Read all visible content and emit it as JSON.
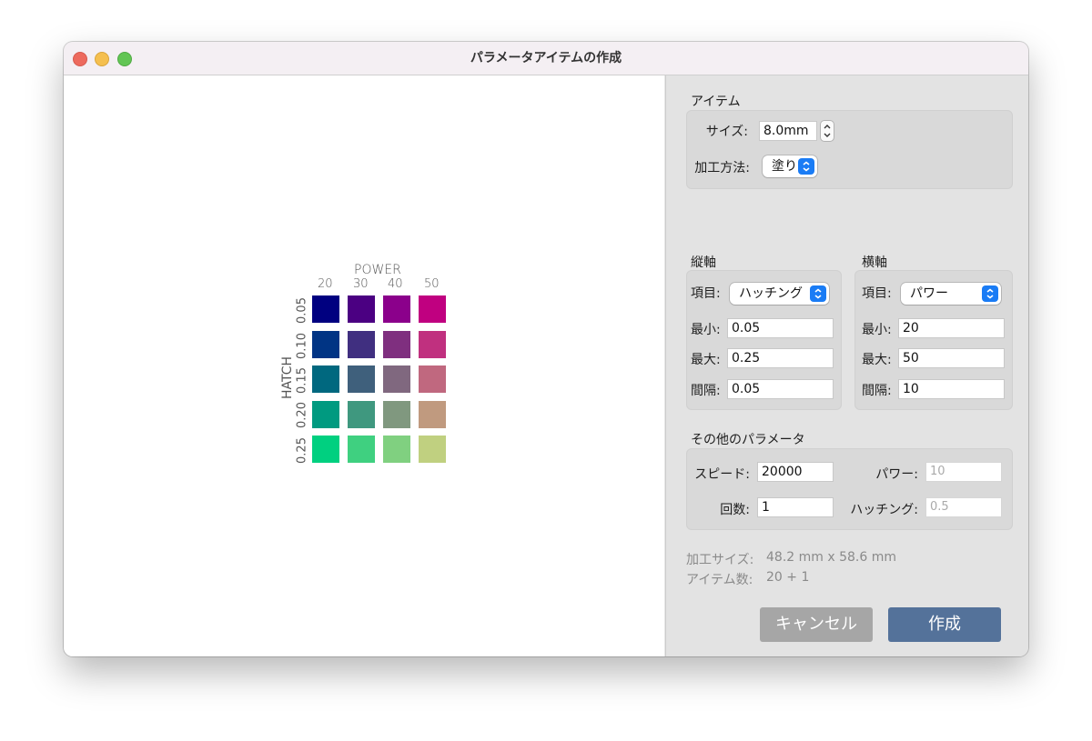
{
  "window": {
    "title": "パラメータアイテムの作成"
  },
  "item": {
    "section_label": "アイテム",
    "size_label": "サイズ:",
    "size_value": "8.0mm",
    "method_label": "加工方法:",
    "method_value": "塗り"
  },
  "vertical_axis": {
    "section_label": "縦軸",
    "item_label": "項目:",
    "item_value": "ハッチング",
    "min_label": "最小:",
    "min_value": "0.05",
    "max_label": "最大:",
    "max_value": "0.25",
    "step_label": "間隔:",
    "step_value": "0.05"
  },
  "horizontal_axis": {
    "section_label": "横軸",
    "item_label": "項目:",
    "item_value": "パワー",
    "min_label": "最小:",
    "min_value": "20",
    "max_label": "最大:",
    "max_value": "50",
    "step_label": "間隔:",
    "step_value": "10"
  },
  "other": {
    "section_label": "その他のパラメータ",
    "speed_label": "スピード:",
    "speed_value": "20000",
    "count_label": "回数:",
    "count_value": "1",
    "power_label": "パワー:",
    "power_value": "10",
    "hatch_label": "ハッチング:",
    "hatch_value": "0.5"
  },
  "info": {
    "size_label": "加工サイズ:",
    "size_value": "48.2 mm x 58.6 mm",
    "count_label": "アイテム数:",
    "count_value": "20 + 1"
  },
  "buttons": {
    "cancel": "キャンセル",
    "create": "作成"
  },
  "preview": {
    "x_title": "POWER",
    "y_title": "HATCH",
    "x_ticks": [
      "20",
      "30",
      "40",
      "50"
    ],
    "y_ticks": [
      "0.05",
      "0.10",
      "0.15",
      "0.20",
      "0.25"
    ],
    "grid_colors": [
      [
        "#000080",
        "#4b0082",
        "#8b008b",
        "#c00080"
      ],
      [
        "#003484",
        "#402f80",
        "#7f2f7f",
        "#c0307f"
      ],
      [
        "#00687f",
        "#3f607c",
        "#80687f",
        "#c0687f"
      ],
      [
        "#009a80",
        "#3f987f",
        "#80987f",
        "#c09a7f"
      ],
      [
        "#00d080",
        "#3fd080",
        "#80d080",
        "#c0d080"
      ]
    ]
  },
  "colors": {
    "accent": "#1a7cf5",
    "create_button": "#54729a",
    "cancel_button": "#a6a6a6"
  }
}
